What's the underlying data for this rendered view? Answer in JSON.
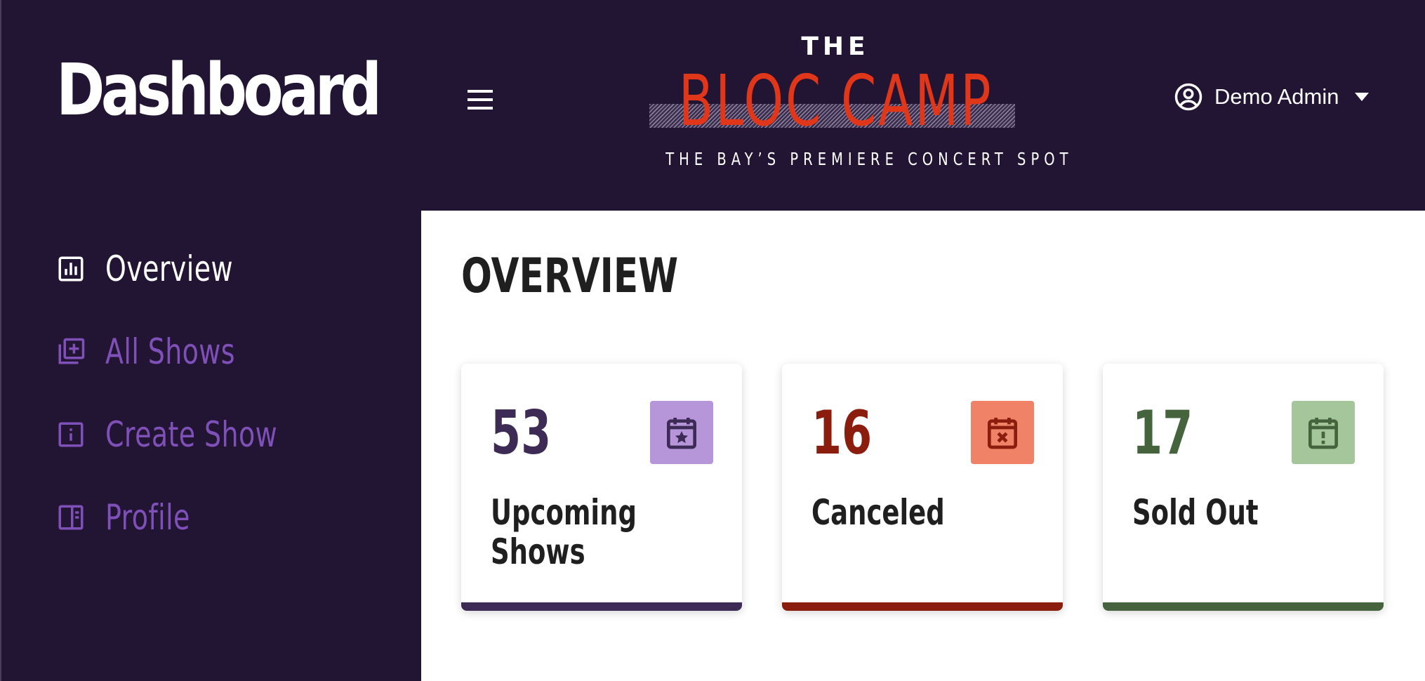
{
  "sidebar": {
    "title": "Dashboard",
    "items": [
      {
        "label": "Overview",
        "icon": "bar-chart-icon",
        "active": true
      },
      {
        "label": "All Shows",
        "icon": "library-add-icon",
        "active": false
      },
      {
        "label": "Create Show",
        "icon": "info-icon",
        "active": false
      },
      {
        "label": "Profile",
        "icon": "profile-panel-icon",
        "active": false
      }
    ]
  },
  "header": {
    "menu_icon": "hamburger-menu-icon",
    "logo": {
      "the": "THE",
      "name": "BLOC CAMP",
      "tagline": "THE BAY’S PREMIERE CONCERT SPOT"
    },
    "user": {
      "name": "Demo Admin",
      "icon": "account-circle-icon",
      "caret_icon": "caret-down-icon"
    }
  },
  "main": {
    "title": "OVERVIEW",
    "cards": [
      {
        "count": "53",
        "label": "Upcoming Shows",
        "icon": "calendar-star-icon",
        "accent": "#3d2b55",
        "badge_bg": "#b696d8"
      },
      {
        "count": "16",
        "label": "Canceled",
        "icon": "calendar-x-icon",
        "accent": "#8b1d0e",
        "badge_bg": "#f08268"
      },
      {
        "count": "17",
        "label": "Sold Out",
        "icon": "calendar-alert-icon",
        "accent": "#45633d",
        "badge_bg": "#a5c59a"
      }
    ]
  },
  "colors": {
    "background": "#221433",
    "accent_red": "#e0361a",
    "nav_inactive": "#7e50b8"
  }
}
